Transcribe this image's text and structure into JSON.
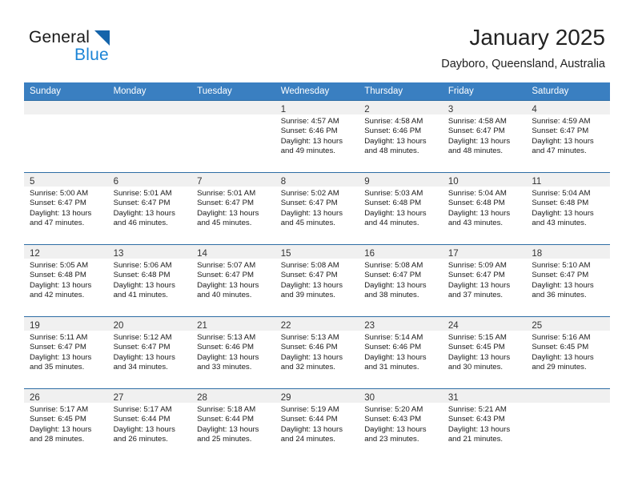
{
  "brand": {
    "word1": "General",
    "word2": "Blue",
    "triangle_color": "#1464aa",
    "blue_text_color": "#1b84d6"
  },
  "header": {
    "title": "January 2025",
    "subtitle": "Dayboro, Queensland, Australia"
  },
  "theme": {
    "header_row_bg": "#3a7fc1",
    "header_row_text": "#ffffff",
    "daynum_bg": "#f0f0f0",
    "row_divider": "#2e6da4"
  },
  "calendar": {
    "weekday_headers": [
      "Sunday",
      "Monday",
      "Tuesday",
      "Wednesday",
      "Thursday",
      "Friday",
      "Saturday"
    ],
    "weeks": [
      [
        {
          "day": "",
          "empty": true
        },
        {
          "day": "",
          "empty": true
        },
        {
          "day": "",
          "empty": true
        },
        {
          "day": "1",
          "sunrise": "Sunrise: 4:57 AM",
          "sunset": "Sunset: 6:46 PM",
          "daylight1": "Daylight: 13 hours",
          "daylight2": "and 49 minutes."
        },
        {
          "day": "2",
          "sunrise": "Sunrise: 4:58 AM",
          "sunset": "Sunset: 6:46 PM",
          "daylight1": "Daylight: 13 hours",
          "daylight2": "and 48 minutes."
        },
        {
          "day": "3",
          "sunrise": "Sunrise: 4:58 AM",
          "sunset": "Sunset: 6:47 PM",
          "daylight1": "Daylight: 13 hours",
          "daylight2": "and 48 minutes."
        },
        {
          "day": "4",
          "sunrise": "Sunrise: 4:59 AM",
          "sunset": "Sunset: 6:47 PM",
          "daylight1": "Daylight: 13 hours",
          "daylight2": "and 47 minutes."
        }
      ],
      [
        {
          "day": "5",
          "sunrise": "Sunrise: 5:00 AM",
          "sunset": "Sunset: 6:47 PM",
          "daylight1": "Daylight: 13 hours",
          "daylight2": "and 47 minutes."
        },
        {
          "day": "6",
          "sunrise": "Sunrise: 5:01 AM",
          "sunset": "Sunset: 6:47 PM",
          "daylight1": "Daylight: 13 hours",
          "daylight2": "and 46 minutes."
        },
        {
          "day": "7",
          "sunrise": "Sunrise: 5:01 AM",
          "sunset": "Sunset: 6:47 PM",
          "daylight1": "Daylight: 13 hours",
          "daylight2": "and 45 minutes."
        },
        {
          "day": "8",
          "sunrise": "Sunrise: 5:02 AM",
          "sunset": "Sunset: 6:47 PM",
          "daylight1": "Daylight: 13 hours",
          "daylight2": "and 45 minutes."
        },
        {
          "day": "9",
          "sunrise": "Sunrise: 5:03 AM",
          "sunset": "Sunset: 6:48 PM",
          "daylight1": "Daylight: 13 hours",
          "daylight2": "and 44 minutes."
        },
        {
          "day": "10",
          "sunrise": "Sunrise: 5:04 AM",
          "sunset": "Sunset: 6:48 PM",
          "daylight1": "Daylight: 13 hours",
          "daylight2": "and 43 minutes."
        },
        {
          "day": "11",
          "sunrise": "Sunrise: 5:04 AM",
          "sunset": "Sunset: 6:48 PM",
          "daylight1": "Daylight: 13 hours",
          "daylight2": "and 43 minutes."
        }
      ],
      [
        {
          "day": "12",
          "sunrise": "Sunrise: 5:05 AM",
          "sunset": "Sunset: 6:48 PM",
          "daylight1": "Daylight: 13 hours",
          "daylight2": "and 42 minutes."
        },
        {
          "day": "13",
          "sunrise": "Sunrise: 5:06 AM",
          "sunset": "Sunset: 6:48 PM",
          "daylight1": "Daylight: 13 hours",
          "daylight2": "and 41 minutes."
        },
        {
          "day": "14",
          "sunrise": "Sunrise: 5:07 AM",
          "sunset": "Sunset: 6:47 PM",
          "daylight1": "Daylight: 13 hours",
          "daylight2": "and 40 minutes."
        },
        {
          "day": "15",
          "sunrise": "Sunrise: 5:08 AM",
          "sunset": "Sunset: 6:47 PM",
          "daylight1": "Daylight: 13 hours",
          "daylight2": "and 39 minutes."
        },
        {
          "day": "16",
          "sunrise": "Sunrise: 5:08 AM",
          "sunset": "Sunset: 6:47 PM",
          "daylight1": "Daylight: 13 hours",
          "daylight2": "and 38 minutes."
        },
        {
          "day": "17",
          "sunrise": "Sunrise: 5:09 AM",
          "sunset": "Sunset: 6:47 PM",
          "daylight1": "Daylight: 13 hours",
          "daylight2": "and 37 minutes."
        },
        {
          "day": "18",
          "sunrise": "Sunrise: 5:10 AM",
          "sunset": "Sunset: 6:47 PM",
          "daylight1": "Daylight: 13 hours",
          "daylight2": "and 36 minutes."
        }
      ],
      [
        {
          "day": "19",
          "sunrise": "Sunrise: 5:11 AM",
          "sunset": "Sunset: 6:47 PM",
          "daylight1": "Daylight: 13 hours",
          "daylight2": "and 35 minutes."
        },
        {
          "day": "20",
          "sunrise": "Sunrise: 5:12 AM",
          "sunset": "Sunset: 6:47 PM",
          "daylight1": "Daylight: 13 hours",
          "daylight2": "and 34 minutes."
        },
        {
          "day": "21",
          "sunrise": "Sunrise: 5:13 AM",
          "sunset": "Sunset: 6:46 PM",
          "daylight1": "Daylight: 13 hours",
          "daylight2": "and 33 minutes."
        },
        {
          "day": "22",
          "sunrise": "Sunrise: 5:13 AM",
          "sunset": "Sunset: 6:46 PM",
          "daylight1": "Daylight: 13 hours",
          "daylight2": "and 32 minutes."
        },
        {
          "day": "23",
          "sunrise": "Sunrise: 5:14 AM",
          "sunset": "Sunset: 6:46 PM",
          "daylight1": "Daylight: 13 hours",
          "daylight2": "and 31 minutes."
        },
        {
          "day": "24",
          "sunrise": "Sunrise: 5:15 AM",
          "sunset": "Sunset: 6:45 PM",
          "daylight1": "Daylight: 13 hours",
          "daylight2": "and 30 minutes."
        },
        {
          "day": "25",
          "sunrise": "Sunrise: 5:16 AM",
          "sunset": "Sunset: 6:45 PM",
          "daylight1": "Daylight: 13 hours",
          "daylight2": "and 29 minutes."
        }
      ],
      [
        {
          "day": "26",
          "sunrise": "Sunrise: 5:17 AM",
          "sunset": "Sunset: 6:45 PM",
          "daylight1": "Daylight: 13 hours",
          "daylight2": "and 28 minutes."
        },
        {
          "day": "27",
          "sunrise": "Sunrise: 5:17 AM",
          "sunset": "Sunset: 6:44 PM",
          "daylight1": "Daylight: 13 hours",
          "daylight2": "and 26 minutes."
        },
        {
          "day": "28",
          "sunrise": "Sunrise: 5:18 AM",
          "sunset": "Sunset: 6:44 PM",
          "daylight1": "Daylight: 13 hours",
          "daylight2": "and 25 minutes."
        },
        {
          "day": "29",
          "sunrise": "Sunrise: 5:19 AM",
          "sunset": "Sunset: 6:44 PM",
          "daylight1": "Daylight: 13 hours",
          "daylight2": "and 24 minutes."
        },
        {
          "day": "30",
          "sunrise": "Sunrise: 5:20 AM",
          "sunset": "Sunset: 6:43 PM",
          "daylight1": "Daylight: 13 hours",
          "daylight2": "and 23 minutes."
        },
        {
          "day": "31",
          "sunrise": "Sunrise: 5:21 AM",
          "sunset": "Sunset: 6:43 PM",
          "daylight1": "Daylight: 13 hours",
          "daylight2": "and 21 minutes."
        },
        {
          "day": "",
          "empty": true
        }
      ]
    ]
  }
}
